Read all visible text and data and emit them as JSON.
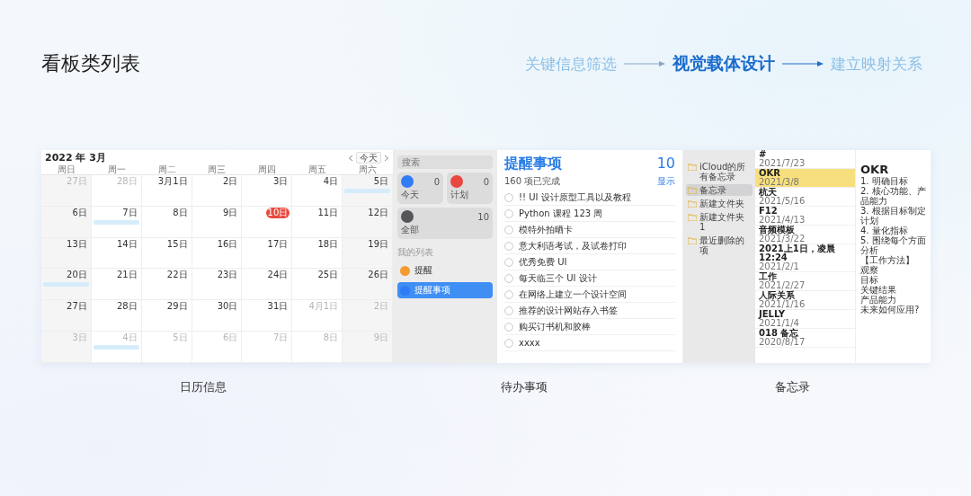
{
  "title": "看板类列表",
  "steps": [
    {
      "label": "关键信息筛选",
      "selected": false
    },
    {
      "label": "视觉载体设计",
      "selected": true
    },
    {
      "label": "建立映射关系",
      "selected": false
    }
  ],
  "calendar": {
    "month": "2022 年 3月",
    "today_button": "今天",
    "weekdays": [
      "周日",
      "周一",
      "周二",
      "周三",
      "周四",
      "周五",
      "周六"
    ],
    "weeks": [
      [
        {
          "date": "27日",
          "dim": true,
          "today": false,
          "event": false
        },
        {
          "date": "28日",
          "dim": true,
          "today": false,
          "event": false
        },
        {
          "date": "3月1日",
          "dim": false,
          "today": false,
          "event": false
        },
        {
          "date": "2日",
          "dim": false,
          "today": false,
          "event": false
        },
        {
          "date": "3日",
          "dim": false,
          "today": false,
          "event": false
        },
        {
          "date": "4日",
          "dim": false,
          "today": false,
          "event": false
        },
        {
          "date": "5日",
          "dim": false,
          "today": false,
          "event": true
        }
      ],
      [
        {
          "date": "6日",
          "dim": false,
          "today": false,
          "event": false
        },
        {
          "date": "7日",
          "dim": false,
          "today": false,
          "event": true
        },
        {
          "date": "8日",
          "dim": false,
          "today": false,
          "event": false
        },
        {
          "date": "9日",
          "dim": false,
          "today": false,
          "event": false
        },
        {
          "date": "10日",
          "dim": false,
          "today": true,
          "event": false
        },
        {
          "date": "11日",
          "dim": false,
          "today": false,
          "event": false
        },
        {
          "date": "12日",
          "dim": false,
          "today": false,
          "event": false
        }
      ],
      [
        {
          "date": "13日",
          "dim": false,
          "today": false,
          "event": false
        },
        {
          "date": "14日",
          "dim": false,
          "today": false,
          "event": false
        },
        {
          "date": "15日",
          "dim": false,
          "today": false,
          "event": false
        },
        {
          "date": "16日",
          "dim": false,
          "today": false,
          "event": false
        },
        {
          "date": "17日",
          "dim": false,
          "today": false,
          "event": false
        },
        {
          "date": "18日",
          "dim": false,
          "today": false,
          "event": false
        },
        {
          "date": "19日",
          "dim": false,
          "today": false,
          "event": false
        }
      ],
      [
        {
          "date": "20日",
          "dim": false,
          "today": false,
          "event": true
        },
        {
          "date": "21日",
          "dim": false,
          "today": false,
          "event": false
        },
        {
          "date": "22日",
          "dim": false,
          "today": false,
          "event": false
        },
        {
          "date": "23日",
          "dim": false,
          "today": false,
          "event": false
        },
        {
          "date": "24日",
          "dim": false,
          "today": false,
          "event": false
        },
        {
          "date": "25日",
          "dim": false,
          "today": false,
          "event": false
        },
        {
          "date": "26日",
          "dim": false,
          "today": false,
          "event": false
        }
      ],
      [
        {
          "date": "27日",
          "dim": false,
          "today": false,
          "event": false
        },
        {
          "date": "28日",
          "dim": false,
          "today": false,
          "event": false
        },
        {
          "date": "29日",
          "dim": false,
          "today": false,
          "event": false
        },
        {
          "date": "30日",
          "dim": false,
          "today": false,
          "event": false
        },
        {
          "date": "31日",
          "dim": false,
          "today": false,
          "event": false
        },
        {
          "date": "4月1日",
          "dim": true,
          "today": false,
          "event": false
        },
        {
          "date": "2日",
          "dim": true,
          "today": false,
          "event": false
        }
      ],
      [
        {
          "date": "3日",
          "dim": true,
          "today": false,
          "event": false
        },
        {
          "date": "4日",
          "dim": true,
          "today": false,
          "event": true
        },
        {
          "date": "5日",
          "dim": true,
          "today": false,
          "event": false
        },
        {
          "date": "6日",
          "dim": true,
          "today": false,
          "event": false
        },
        {
          "date": "7日",
          "dim": true,
          "today": false,
          "event": false
        },
        {
          "date": "8日",
          "dim": true,
          "today": false,
          "event": false
        },
        {
          "date": "9日",
          "dim": true,
          "today": false,
          "event": false
        }
      ]
    ]
  },
  "reminders": {
    "search": {
      "placeholder": "搜索"
    },
    "smart_lists": [
      {
        "label": "今天",
        "count": "0",
        "color": "#2f7cf6"
      },
      {
        "label": "计划",
        "count": "0",
        "color": "#e8483f"
      },
      {
        "label": "全部",
        "count": "10",
        "color": "#55565a"
      }
    ],
    "section": "我的列表",
    "lists": [
      {
        "label": "提醒",
        "color": "#f59a2c",
        "selected": false
      },
      {
        "label": "提醒事项",
        "color": "#2f7cf6",
        "selected": true
      }
    ],
    "title": "提醒事项",
    "count": "10",
    "completed": "160 项已完成",
    "show": "显示",
    "items": [
      {
        "text": "!! UI 设计原型工具以及教程",
        "checked": false
      },
      {
        "text": "Python 课程 123 周",
        "checked": false
      },
      {
        "text": "模特外拍晒卡",
        "checked": false
      },
      {
        "text": "意大利语考试，及试卷打印",
        "checked": false
      },
      {
        "text": "优秀免费 UI",
        "checked": false
      },
      {
        "text": "每天临三个 UI 设计",
        "checked": false
      },
      {
        "text": "在网络上建立一个设计空间",
        "checked": false
      },
      {
        "text": "推荐的设计网站存入书签",
        "checked": false
      },
      {
        "text": "购买订书机和胶棒",
        "checked": false
      },
      {
        "text": "xxxx",
        "checked": false
      }
    ]
  },
  "notes": {
    "folders": [
      {
        "label": "iCloud的所有备忘录",
        "selected": false
      },
      {
        "label": "备忘录",
        "selected": true
      },
      {
        "label": "新建文件夹",
        "selected": false
      },
      {
        "label": "新建文件夹 1",
        "selected": false
      },
      {
        "label": "最近删除的项",
        "selected": false
      }
    ],
    "list": [
      {
        "title": "#",
        "date": "2021/7/23",
        "selected": false
      },
      {
        "title": "OKR",
        "date": "2021/3/8",
        "selected": true
      },
      {
        "title": "杭天",
        "date": "2021/5/16",
        "selected": false
      },
      {
        "title": "F12",
        "date": "2021/4/13",
        "selected": false
      },
      {
        "title": "音频模板",
        "date": "2021/3/22",
        "selected": false
      },
      {
        "title": "2021上1日，凌晨12:24",
        "date": "2021/2/1",
        "selected": false
      },
      {
        "title": "工作",
        "date": "2021/2/27",
        "selected": false
      },
      {
        "title": "人际关系",
        "date": "2021/1/16",
        "selected": false
      },
      {
        "title": "JELLY",
        "date": "2021/1/4",
        "selected": false
      },
      {
        "title": "018 备忘",
        "date": "2020/8/17",
        "selected": false
      }
    ],
    "detail": {
      "heading": "OKR",
      "lines": [
        "1. 明确目标",
        "2. 核心功能、产品能力",
        "3. 根据目标制定计划",
        "4. 量化指标",
        "5. 围绕每个方面分析",
        "【工作方法】",
        "观察",
        "目标",
        "关键结果",
        "产品能力",
        "未来如何应用?"
      ]
    }
  },
  "captions": [
    "日历信息",
    "待办事项",
    "备忘录"
  ]
}
